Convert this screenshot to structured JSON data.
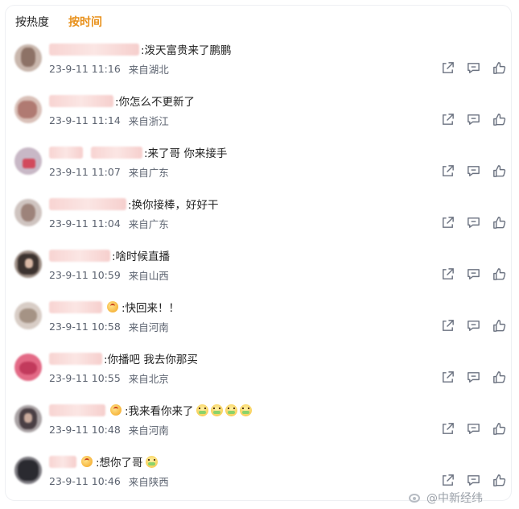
{
  "tabs": [
    {
      "label": "按热度",
      "active": false
    },
    {
      "label": "按时间",
      "active": true
    }
  ],
  "accent_color": "#e8901a",
  "comments": [
    {
      "text": ":泼天富贵来了鹏鹏",
      "time": "23-9-11 11:16",
      "location": "来自湖北",
      "badge": false,
      "emoji_count": 0
    },
    {
      "text": ":你怎么不更新了",
      "time": "23-9-11 11:14",
      "location": "来自浙江",
      "badge": false,
      "emoji_count": 0
    },
    {
      "text": ":来了哥 你来接手",
      "time": "23-9-11 11:07",
      "location": "来自广东",
      "badge": false,
      "emoji_count": 0
    },
    {
      "text": ":换你接棒，好好干",
      "time": "23-9-11 11:04",
      "location": "来自广东",
      "badge": false,
      "emoji_count": 0
    },
    {
      "text": ":啥时候直播",
      "time": "23-9-11 10:59",
      "location": "来自山西",
      "badge": false,
      "emoji_count": 0
    },
    {
      "text": ":快回来！！",
      "time": "23-9-11 10:58",
      "location": "来自河南",
      "badge": true,
      "emoji_count": 0
    },
    {
      "text": ":你播吧 我去你那买",
      "time": "23-9-11 10:55",
      "location": "来自北京",
      "badge": false,
      "emoji_count": 0
    },
    {
      "text": ":我来看你来了",
      "time": "23-9-11 10:48",
      "location": "来自河南",
      "badge": true,
      "emoji_count": 4
    },
    {
      "text": ":想你了哥",
      "time": "23-9-11 10:46",
      "location": "来自陕西",
      "badge": true,
      "emoji_count": 1
    }
  ],
  "action_icons": [
    "share-icon",
    "comment-icon",
    "like-icon"
  ],
  "watermark": {
    "text": "@中新经纬",
    "icon": "weibo-logo-icon"
  }
}
